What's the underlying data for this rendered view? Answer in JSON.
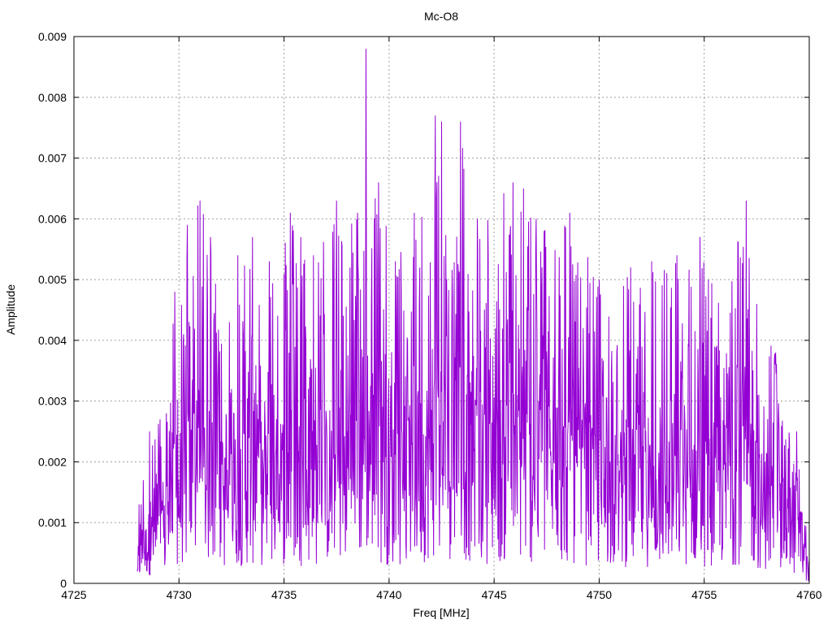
{
  "chart_data": {
    "type": "line",
    "title": "Mc-O8",
    "xlabel": "Freq [MHz]",
    "ylabel": "Amplitude",
    "xlim": [
      4725,
      4760
    ],
    "ylim": [
      0,
      0.009
    ],
    "x_ticks": [
      "4725",
      "4730",
      "4735",
      "4740",
      "4745",
      "4750",
      "4755",
      "4760"
    ],
    "y_ticks": [
      "0",
      "0.001",
      "0.002",
      "0.003",
      "0.004",
      "0.005",
      "0.006",
      "0.007",
      "0.008",
      "0.009"
    ],
    "grid": true,
    "series": [
      {
        "color": "#9400d3",
        "x_start": 4728.0,
        "x_end": 4760.0,
        "peaks": [
          [
            4728.0,
            0.0002
          ],
          [
            4728.1,
            0.0013
          ],
          [
            4728.3,
            0.0017
          ],
          [
            4728.6,
            0.0025
          ],
          [
            4729.1,
            0.0027
          ],
          [
            4729.4,
            0.0028
          ],
          [
            4729.8,
            0.0048
          ],
          [
            4730.4,
            0.0059
          ],
          [
            4731.0,
            0.0063
          ],
          [
            4731.5,
            0.0057
          ],
          [
            4732.4,
            0.0043
          ],
          [
            4732.8,
            0.0054
          ],
          [
            4733.5,
            0.0057
          ],
          [
            4734.3,
            0.0053
          ],
          [
            4735.3,
            0.0061
          ],
          [
            4735.8,
            0.0057
          ],
          [
            4736.4,
            0.0054
          ],
          [
            4737.5,
            0.0063
          ],
          [
            4738.5,
            0.0061
          ],
          [
            4738.9,
            0.0088
          ],
          [
            4739.5,
            0.0066
          ],
          [
            4740.3,
            0.0053
          ],
          [
            4741.2,
            0.0061
          ],
          [
            4742.2,
            0.0077
          ],
          [
            4742.5,
            0.0076
          ],
          [
            4743.4,
            0.0076
          ],
          [
            4744.2,
            0.006
          ],
          [
            4745.9,
            0.0066
          ],
          [
            4746.4,
            0.0065
          ],
          [
            4747.0,
            0.006
          ],
          [
            4748.6,
            0.0061
          ],
          [
            4750.0,
            0.005
          ],
          [
            4751.5,
            0.0052
          ],
          [
            4752.5,
            0.0053
          ],
          [
            4753.7,
            0.0054
          ],
          [
            4754.8,
            0.0057
          ],
          [
            4755.2,
            0.005
          ],
          [
            4757.0,
            0.0063
          ],
          [
            4757.5,
            0.0046
          ],
          [
            4758.4,
            0.0038
          ],
          [
            4759.4,
            0.0025
          ],
          [
            4760.0,
            0.0004
          ]
        ]
      }
    ]
  }
}
